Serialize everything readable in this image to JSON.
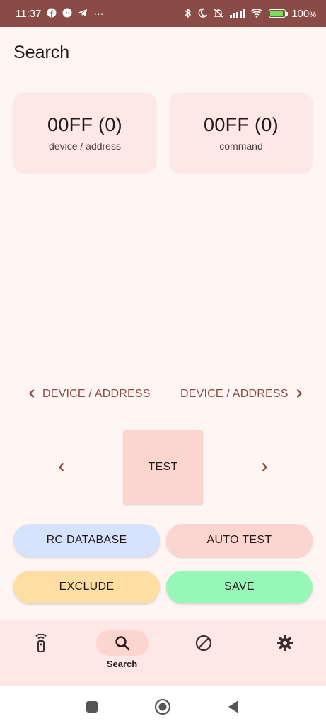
{
  "status_bar": {
    "time": "11:37",
    "overflow": "···",
    "battery": "100",
    "battery_unit": "%"
  },
  "page": {
    "title": "Search"
  },
  "cards": [
    {
      "value": "00FF (0)",
      "label": "device / address"
    },
    {
      "value": "00FF (0)",
      "label": "command"
    }
  ],
  "device_nav": {
    "prev_label": "DEVICE / ADDRESS",
    "next_label": "DEVICE / ADDRESS"
  },
  "test_button": {
    "label": "TEST"
  },
  "buttons": {
    "rc_database": "RC DATABASE",
    "auto_test": "AUTO TEST",
    "exclude": "EXCLUDE",
    "save": "SAVE"
  },
  "colors": {
    "accent": "#8a4a46",
    "rc_database_bg": "#d6e3ff",
    "auto_test_bg": "#fdd5d0",
    "exclude_bg": "#ffdea3",
    "save_bg": "#97f7b8"
  },
  "bottom_nav": {
    "items": [
      {
        "icon": "remote-icon",
        "label": ""
      },
      {
        "icon": "search-icon",
        "label": "Search",
        "active": true
      },
      {
        "icon": "block-icon",
        "label": ""
      },
      {
        "icon": "gear-icon",
        "label": ""
      }
    ]
  }
}
